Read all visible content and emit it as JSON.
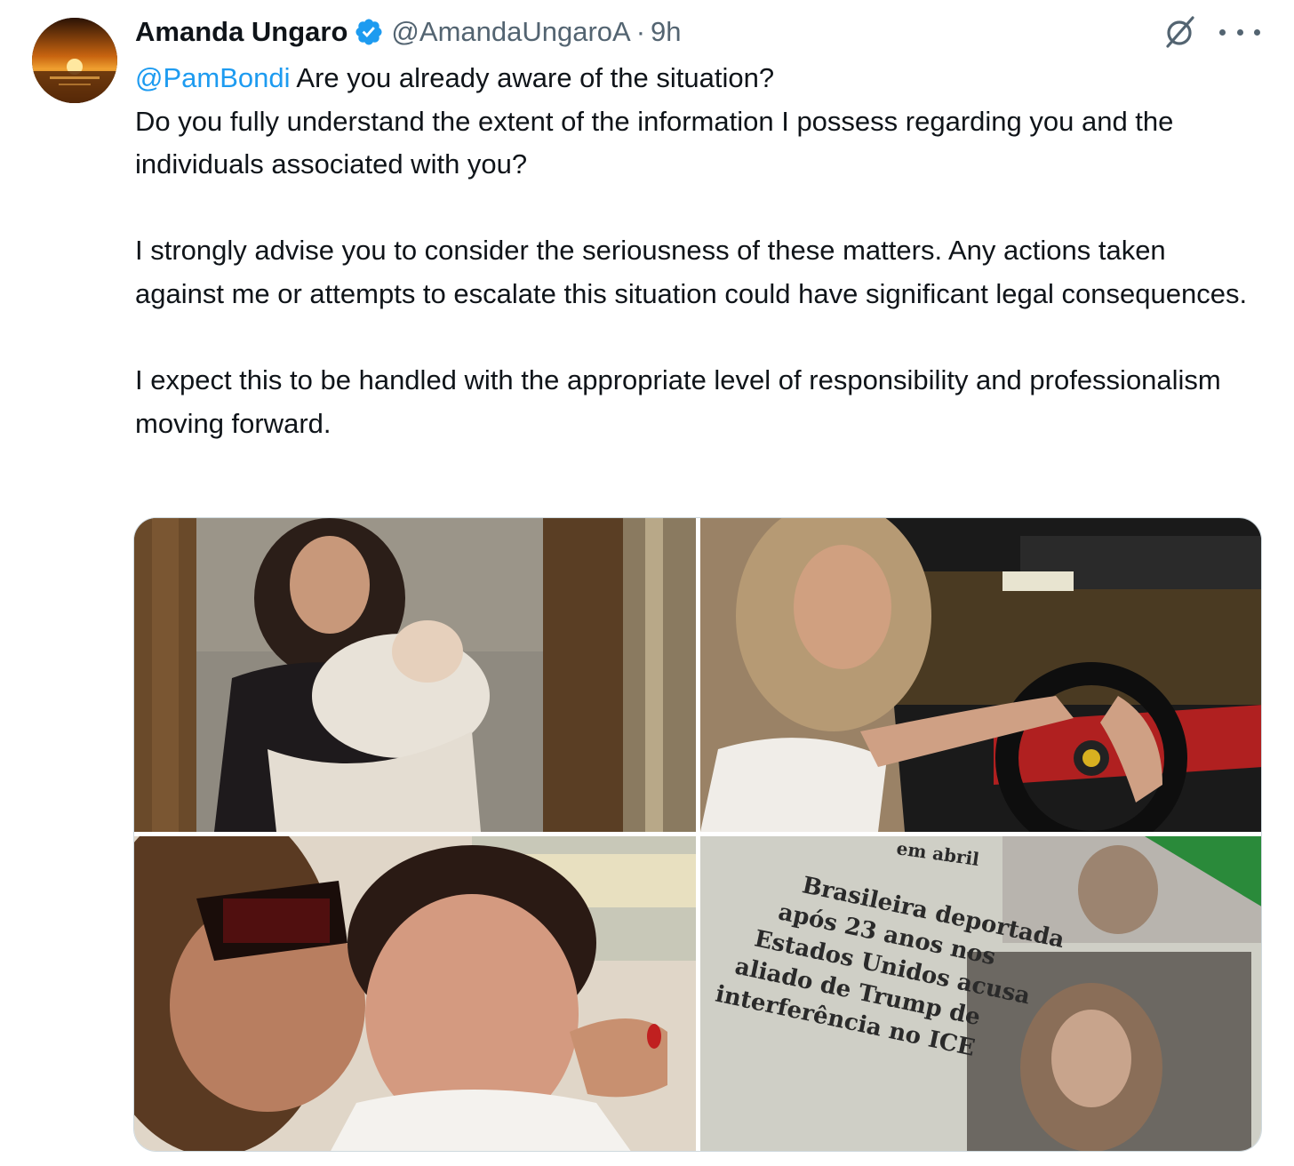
{
  "author": {
    "name": "Amanda Ungaro",
    "handle": "@AmandaUngaroA",
    "separator": "·",
    "time": "9h",
    "verified": true,
    "verified_color": "#1d9bf0"
  },
  "tweet": {
    "mention": "@PamBondi",
    "line1_rest": " Are you already aware of the situation?",
    "line2": "Do you fully understand the extent of the information I possess regarding you and the individuals associated with you?",
    "paragraph2": "I strongly advise you to consider the seriousness of these matters. Any actions taken against me or attempts to escalate this situation could have significant legal consequences.",
    "paragraph3": "I expect this to be handled with the appropriate level of responsibility and professionalism moving forward."
  },
  "actions": {
    "grok_icon": "grok-icon",
    "more_icon": "more-icon"
  },
  "media": {
    "photos": [
      {
        "icon": "framed-photo-mother-baby"
      },
      {
        "icon": "woman-driving-car"
      },
      {
        "icon": "woman-kissing-boy"
      },
      {
        "icon": "newspaper-clipping",
        "headline": [
          "Brasileira deportada",
          "após 23 anos nos",
          "Estados Unidos acusa",
          "aliado de Trump de",
          "interferência no ICE"
        ],
        "top_text": "em abril"
      }
    ]
  },
  "colors": {
    "mention": "#1d9bf0",
    "secondary_text": "#536471",
    "primary_text": "#0f1419"
  }
}
